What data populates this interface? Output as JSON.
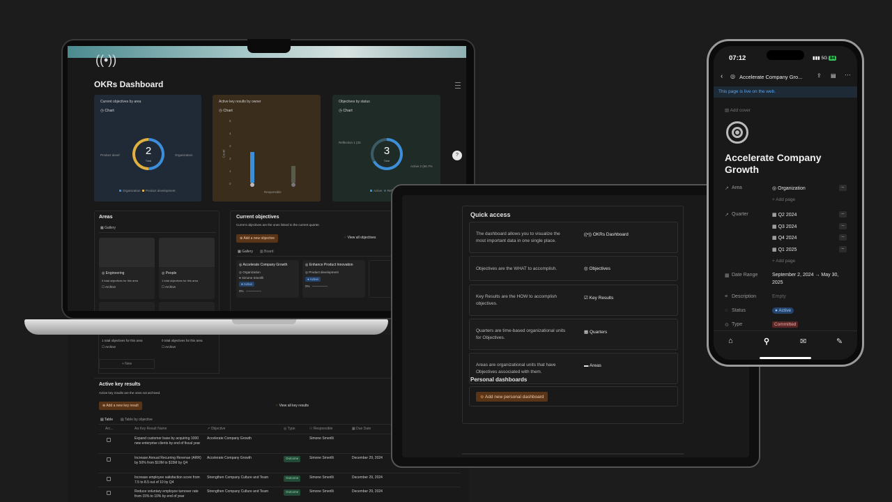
{
  "laptop": {
    "title": "OKRs Dashboard",
    "charts": [
      {
        "title": "Current objectives by area",
        "tab": "Chart",
        "total": "2",
        "total_label": "Total",
        "left_label": "Product devel",
        "right_label": "Organization",
        "legend": [
          "Organization",
          "Product development"
        ]
      },
      {
        "title": "Active key results by owner",
        "tab": "Chart",
        "y_axis": "Count",
        "x_axis": "Responsible",
        "ticks": [
          "0",
          "1",
          "2",
          "3",
          "4",
          "5"
        ],
        "bar_values": [
          4,
          2
        ]
      },
      {
        "title": "Objectives by status",
        "tab": "Chart",
        "total": "3",
        "total_label": "Total",
        "left_label": "Reflection 1 (33",
        "right_label": "Active 2 (66.7%",
        "legend": [
          "Active",
          "Reflection"
        ]
      }
    ],
    "areas": {
      "title": "Areas",
      "tab": "Gallery",
      "cards": [
        {
          "name": "Engineering",
          "count": "0 total objectives for this area",
          "archive": "Archive"
        },
        {
          "name": "People",
          "count": "1 total objectives for this area",
          "archive": "Archive"
        }
      ],
      "lower_cards": [
        {
          "count": "1 total objectives for this area",
          "archive": "Archive"
        },
        {
          "count": "0 total objectives for this area",
          "archive": "Archive"
        }
      ],
      "new": "+ New"
    },
    "current_objectives": {
      "title": "Current objectives",
      "subtitle": "Current objectives are the ones linked to the current quarter.",
      "add_button": "Add a new objective",
      "view_all": "View all objectives",
      "tabs": [
        "Gallery",
        "Board"
      ],
      "cards": [
        {
          "name": "Accelerate Company Growth",
          "area": "Organization",
          "owner": "Simone Smerilli",
          "status": "Active",
          "progress": "0%"
        },
        {
          "name": "Enhance Product Innovation",
          "area": "Product development",
          "status": "Active",
          "progress": "0%"
        }
      ]
    },
    "key_results": {
      "title": "Active key results",
      "subtitle": "Active key results are the ones not archived.",
      "add_button": "Add a new key result",
      "view_all": "View all key results",
      "tabs": [
        "Table",
        "Table by objective"
      ],
      "columns": [
        "Arc...",
        "Key Result Name",
        "Objective",
        "Type",
        "Responsible",
        "Due Date"
      ],
      "rows": [
        {
          "name": "Expand customer base by acquiring 1000 new enterprise clients by end of fiscal year",
          "objective": "Accelerate Company Growth",
          "type": "",
          "responsible": "Simone Smerilli",
          "due": ""
        },
        {
          "name": "Increase Annual Recurring Revenue (ARR) by 50% from $10M to $15M by Q4",
          "objective": "Accelerate Company Growth",
          "type": "Outcome",
          "responsible": "Simone Smerilli",
          "due": "December 29, 2024"
        },
        {
          "name": "Increase employee satisfaction score from 7.5 to 8.5 out of 10 by Q4",
          "objective": "Strengthen Company Culture and Team",
          "type": "Outcome",
          "responsible": "Simone Smerilli",
          "due": "December 29, 2024"
        },
        {
          "name": "Reduce voluntary employee turnover rate from 15% to 10% by end of year",
          "objective": "Strengthen Company Culture and Team",
          "type": "Outcome",
          "responsible": "Simone Smerilli",
          "due": "December 29, 2024"
        }
      ]
    }
  },
  "tablet": {
    "quick_access_title": "Quick access",
    "rows": [
      {
        "desc": "The dashboard allows you to visualize the most important data in one single place.",
        "link": "OKRs Dashboard",
        "icon": "broadcast-icon"
      },
      {
        "desc": "Objectives are the WHAT to accomplish.",
        "link": "Objectives",
        "icon": "target-icon"
      },
      {
        "desc": "Key Results are the HOW to accomplish objectives.",
        "link": "Key Results",
        "icon": "checkbox-icon"
      },
      {
        "desc": "Quarters are time-based organizational units for Objectives.",
        "link": "Quarters",
        "icon": "calendar-icon"
      },
      {
        "desc": "Areas are organizational units that have Objectives associated with them.",
        "link": "Areas",
        "icon": "folder-icon"
      }
    ],
    "personal_title": "Personal dashboards",
    "add_personal": "Add new personal dashboard"
  },
  "phone": {
    "time": "07:12",
    "signal": "5G",
    "battery": "84",
    "nav_title": "Accelerate Company Gro...",
    "live": "This page is live on the web.",
    "add_cover": "Add cover",
    "title_line1": "Accelerate Company",
    "title_line2": "Growth",
    "props": {
      "area_label": "Area",
      "area_value": "Organization",
      "add_page": "+ Add page",
      "quarter_label": "Quarter",
      "quarters": [
        "Q2 2024",
        "Q3 2024",
        "Q4 2024",
        "Q1 2025"
      ],
      "add_page2": "+ Add page",
      "date_label": "Date Range",
      "date_value_1": "September 2, 2024 → May 30,",
      "date_value_2": "2025",
      "desc_label": "Description",
      "desc_value": "Empty",
      "status_label": "Status",
      "status_value": "Active",
      "type_label": "Type",
      "type_value": "Committed"
    }
  }
}
